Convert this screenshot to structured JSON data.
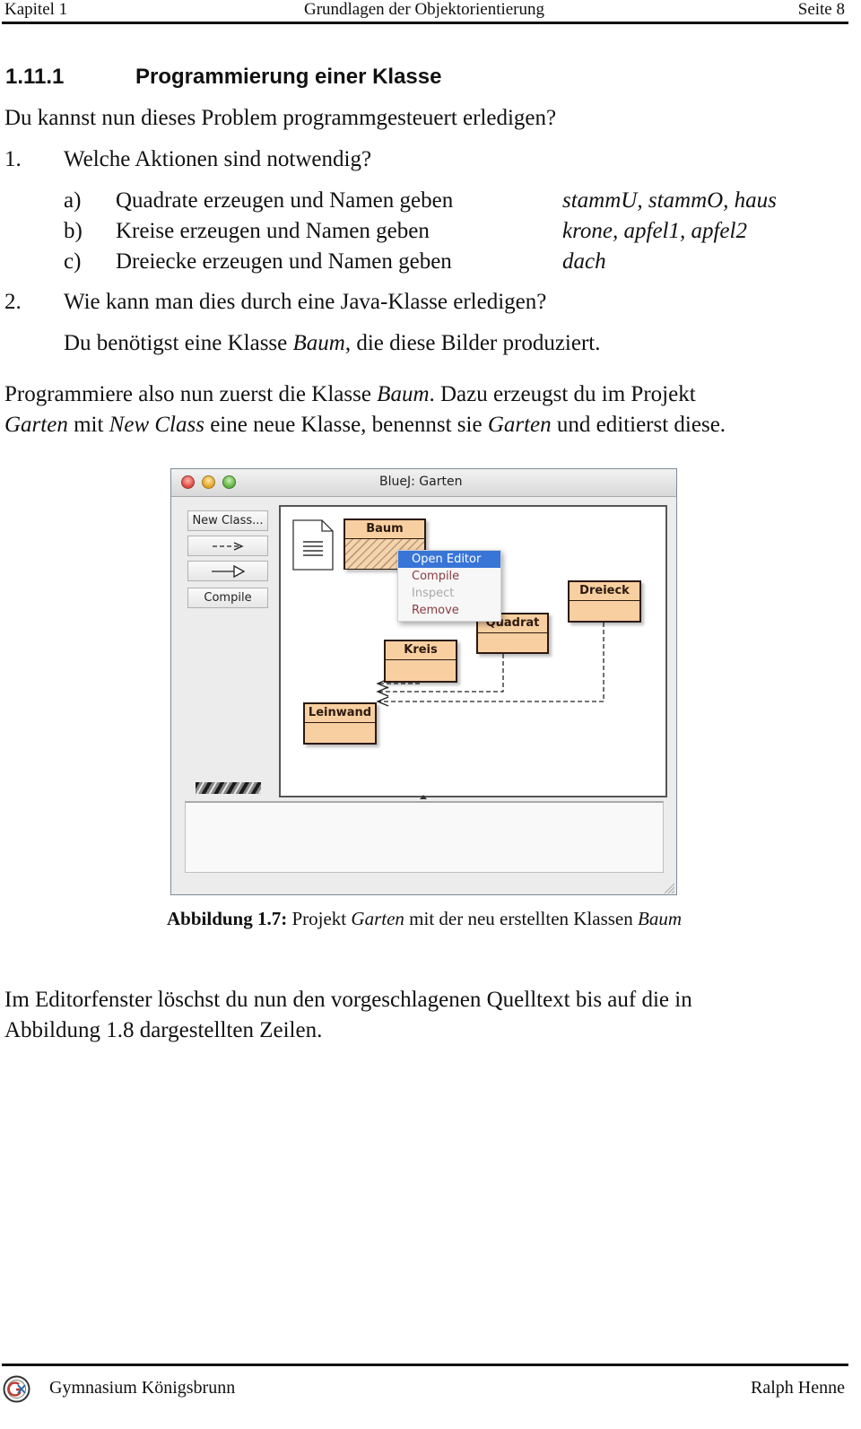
{
  "header": {
    "chapter": "Kapitel 1",
    "title": "Grundlagen der Objektorientierung",
    "page": "Seite 8"
  },
  "section": {
    "number": "1.11.1",
    "title": "Programmierung einer Klasse"
  },
  "intro": "Du kannst nun dieses Problem programmgesteuert erledigen?",
  "questions": [
    {
      "number": "1.",
      "text": "Welche Aktionen sind notwendig?",
      "items": [
        {
          "label": "a)",
          "text": "Quadrate erzeugen und Namen geben",
          "names": "stammU, stammO, haus"
        },
        {
          "label": "b)",
          "text": "Kreise erzeugen und Namen geben",
          "names": "krone, apfel1, apfel2"
        },
        {
          "label": "c)",
          "text": "Dreiecke erzeugen und Namen geben",
          "names": "dach"
        }
      ]
    },
    {
      "number": "2.",
      "text": "Wie kann man dies durch eine Java-Klasse erledigen?",
      "answer": {
        "pre": "Du benötigst eine Klasse ",
        "em": "Baum",
        "post": ", die diese Bilder produziert."
      }
    }
  ],
  "paragraph1": {
    "line1_pre": "Programmiere also nun zuerst die Klasse ",
    "line1_em": "Baum",
    "line1_post": ". Dazu erzeugst du im Projekt",
    "line2_em1": "Garten",
    "line2_t1": " mit ",
    "line2_em2": "New Class",
    "line2_t2": " eine neue Klasse, benennst sie ",
    "line2_em3": "Garten",
    "line2_t3": " und editierst diese."
  },
  "figure": {
    "window_title": "BlueJ:  Garten",
    "toolbar": {
      "new_class": "New Class...",
      "uses_arrow": "---->",
      "inherits_arrow": "—▷",
      "compile": "Compile"
    },
    "classes": [
      {
        "name": "Baum",
        "state": "uncompiled"
      },
      {
        "name": "Dreieck",
        "state": "compiled"
      },
      {
        "name": "Quadrat",
        "state": "compiled"
      },
      {
        "name": "Kreis",
        "state": "compiled"
      },
      {
        "name": "Leinwand",
        "state": "compiled"
      }
    ],
    "dependencies": [
      {
        "from": "Kreis",
        "to": "Leinwand"
      },
      {
        "from": "Quadrat",
        "to": "Leinwand"
      },
      {
        "from": "Dreieck",
        "to": "Leinwand"
      }
    ],
    "context_menu": [
      {
        "label": "Open Editor",
        "state": "selected"
      },
      {
        "label": "Compile",
        "state": "enabled"
      },
      {
        "label": "Inspect",
        "state": "disabled"
      },
      {
        "label": "Remove",
        "state": "enabled"
      }
    ],
    "caption": {
      "label": "Abbildung 1.7:",
      "pre": " Projekt ",
      "em1": "Garten",
      "mid": " mit der neu erstellten Klassen ",
      "em2": "Baum"
    },
    "colors": {
      "class_fill": "#f8cfa0",
      "menu_selected": "#3875d7",
      "menu_text_enabled": "#8a3b40",
      "menu_text_disabled": "#a9a9a9"
    }
  },
  "paragraph2": {
    "line1": "Im Editorfenster löschst du nun den vorgeschlagenen Quelltext bis auf die in",
    "line2": "Abbildung 1.8 dargestellten Zeilen."
  },
  "footer": {
    "school": "Gymnasium Königsbrunn",
    "author": "Ralph Henne"
  }
}
